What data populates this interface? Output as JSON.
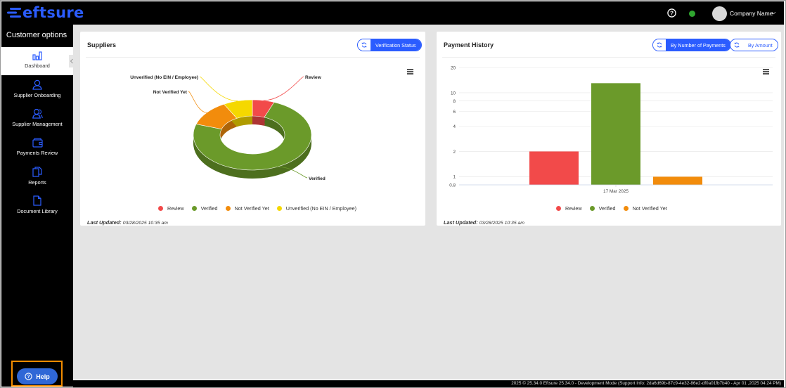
{
  "app": {
    "logo_text": "eftsure"
  },
  "header": {
    "company_name": "Company Name"
  },
  "sidebar": {
    "title": "Customer options",
    "items": [
      {
        "label": "Dashboard",
        "icon": "bar-chart-icon"
      },
      {
        "label": "Supplier Onboarding",
        "icon": "user-add-icon"
      },
      {
        "label": "Supplier Management",
        "icon": "users-icon"
      },
      {
        "label": "Payments Review",
        "icon": "wallet-icon"
      },
      {
        "label": "Reports",
        "icon": "copy-document-icon"
      },
      {
        "label": "Document Library",
        "icon": "document-icon"
      }
    ],
    "help_label": "Help"
  },
  "suppliers_card": {
    "title": "Suppliers",
    "button_label": "Verification Status",
    "last_updated_label": "Last Updated:",
    "last_updated_value": "03/28/2025 10:35 am"
  },
  "payment_card": {
    "title": "Payment History",
    "button_number_label": "By Number of Payments",
    "button_amount_label": "By Amount",
    "last_updated_label": "Last Updated:",
    "last_updated_value": "03/28/2025 10:35 am"
  },
  "colors": {
    "review": "#f24a4a",
    "verified": "#6b9a2a",
    "not_verified_yet": "#f28c0c",
    "unverified": "#f5d800",
    "accent": "#2b5cff"
  },
  "chart_data": [
    {
      "type": "pie",
      "variant": "3d-donut",
      "categories": [
        "Review",
        "Verified",
        "Not Verified Yet",
        "Unverified (No EIN / Employee)"
      ],
      "values": [
        6,
        74,
        12,
        8
      ],
      "legend": [
        "Review",
        "Verified",
        "Not Verified Yet",
        "Unverified (No EIN / Employee)"
      ],
      "legend_position": "bottom"
    },
    {
      "type": "bar",
      "categories": [
        "17 Mar 2025"
      ],
      "series": [
        {
          "name": "Review",
          "values": [
            2
          ]
        },
        {
          "name": "Verified",
          "values": [
            13
          ]
        },
        {
          "name": "Not Verified Yet",
          "values": [
            1
          ]
        }
      ],
      "y_scale": "log",
      "ylim": [
        0.8,
        20
      ],
      "y_ticks": [
        "20",
        "10",
        "8",
        "6",
        "4",
        "2",
        "1",
        "0.8"
      ],
      "legend_position": "bottom"
    }
  ],
  "footer": {
    "text": "2025 © 25.34.0 Eftsure 25.34.0 - Development Mode (Support Info: 2da6d69b-87c9-4e32-86e2-df0a01fb7b40 - Apr 01 ,2025 04:24 PM)"
  }
}
